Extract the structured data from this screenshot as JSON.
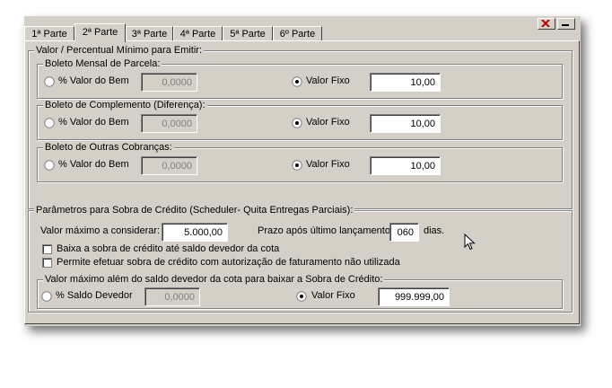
{
  "tabs": [
    "1ª Parte",
    "2ª Parte",
    "3ª Parte",
    "4ª Parte",
    "5ª Parte",
    "6º Parte"
  ],
  "valor_percentual": {
    "legend": "Valor / Percentual Mínimo para Emitir:",
    "groups": [
      {
        "legend": "Boleto Mensal de Parcela:",
        "opt_pct": "% Valor do Bem",
        "pct_value": "0,0000",
        "opt_fixo": "Valor Fixo",
        "fixo_value": "10,00"
      },
      {
        "legend": "Boleto de Complemento (Diferença):",
        "opt_pct": "% Valor do Bem",
        "pct_value": "0,0000",
        "opt_fixo": "Valor Fixo",
        "fixo_value": "10,00"
      },
      {
        "legend": "Boleto de Outras Cobranças:",
        "opt_pct": "% Valor do Bem",
        "pct_value": "0,0000",
        "opt_fixo": "Valor Fixo",
        "fixo_value": "10,00"
      }
    ]
  },
  "parametros": {
    "legend": "Parâmetros para Sobra de Crédito (Scheduler- Quita Entregas Parciais):",
    "valor_maximo_label": "Valor máximo a considerar:",
    "valor_maximo_value": "5.000,00",
    "prazo_label": "Prazo após último lançamento",
    "prazo_value": "060",
    "dias_label": "dias.",
    "checkbox1": "Baixa a sobra de crédito até saldo devedor da cota",
    "checkbox2": "Permite efetuar sobra de crédito com autorização de faturamento não utilizada",
    "sub": {
      "legend": "Valor máximo além do saldo devedor da cota para baixar a Sobra de Crédito:",
      "opt_saldo": "% Saldo Devedor",
      "saldo_value": "0,0000",
      "opt_fixo": "Valor Fixo",
      "fixo_value": "999.999,00"
    }
  }
}
